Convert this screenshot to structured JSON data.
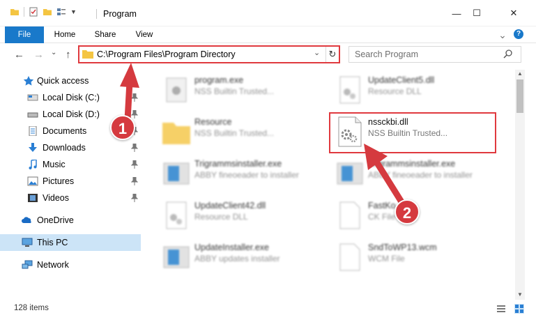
{
  "window": {
    "title": "Program",
    "minimize_glyph": "—",
    "maximize_glyph": "☐",
    "close_glyph": "✕"
  },
  "ribbon": {
    "tabs": [
      "File",
      "Home",
      "Share",
      "View"
    ],
    "expand_glyph": "⌄",
    "help_glyph": "?"
  },
  "nav": {
    "back_glyph": "←",
    "forward_glyph": "→",
    "dropdown_glyph": "⌄",
    "up_glyph": "↑"
  },
  "address": {
    "path": "C:\\Program Files\\Program Directory",
    "dropdown_glyph": "⌄",
    "refresh_glyph": "↻"
  },
  "search": {
    "placeholder": "Search Program"
  },
  "sidebar": {
    "items": [
      {
        "label": "Quick access",
        "icon": "star-icon",
        "pinned": false
      },
      {
        "label": "Local Disk (C:)",
        "icon": "drive-icon",
        "pinned": true
      },
      {
        "label": "Local Disk (D:)",
        "icon": "drive-icon",
        "pinned": true
      },
      {
        "label": "Documents",
        "icon": "documents-icon",
        "pinned": true
      },
      {
        "label": "Downloads",
        "icon": "downloads-icon",
        "pinned": true
      },
      {
        "label": "Music",
        "icon": "music-icon",
        "pinned": true
      },
      {
        "label": "Pictures",
        "icon": "pictures-icon",
        "pinned": true
      },
      {
        "label": "Videos",
        "icon": "videos-icon",
        "pinned": true
      },
      {
        "label": "OneDrive",
        "icon": "cloud-icon",
        "pinned": false
      },
      {
        "label": "This PC",
        "icon": "pc-icon",
        "pinned": false
      },
      {
        "label": "Network",
        "icon": "network-icon",
        "pinned": false
      }
    ]
  },
  "files": [
    {
      "name": "program.exe",
      "desc": "NSS Builtin Trusted...",
      "icon": "exe-icon"
    },
    {
      "name": "UpdateClient5.dll",
      "desc": "Resource DLL",
      "icon": "dll-icon"
    },
    {
      "name": "Resource",
      "desc": "NSS Builtin Trusted...",
      "icon": "folder-icon"
    },
    {
      "name": "nssckbi.dll",
      "desc": "NSS Builtin Trusted...",
      "icon": "dll-gear-icon"
    },
    {
      "name": "Trigrammsinstaller.exe",
      "desc": "ABBY fineoeader to installer",
      "icon": "installer-icon"
    },
    {
      "name": "Trigrammsinstaller.exe",
      "desc": "ABBY fineoeader to installer",
      "icon": "installer-icon"
    },
    {
      "name": "UpdateClient42.dll",
      "desc": "Resource DLL",
      "icon": "dll-icon"
    },
    {
      "name": "FastKo...",
      "desc": "CK File",
      "icon": "file-icon"
    },
    {
      "name": "UpdateInstaller.exe",
      "desc": "ABBY updates installer",
      "icon": "installer-icon"
    },
    {
      "name": "SndToWP13.wcm",
      "desc": "WCM File",
      "icon": "file-icon"
    }
  ],
  "status": {
    "items_count": "128 items"
  },
  "callouts": [
    "1",
    "2"
  ],
  "colors": {
    "accent": "#1979ca",
    "highlight": "#e0393e",
    "selected": "#cce4f7"
  }
}
